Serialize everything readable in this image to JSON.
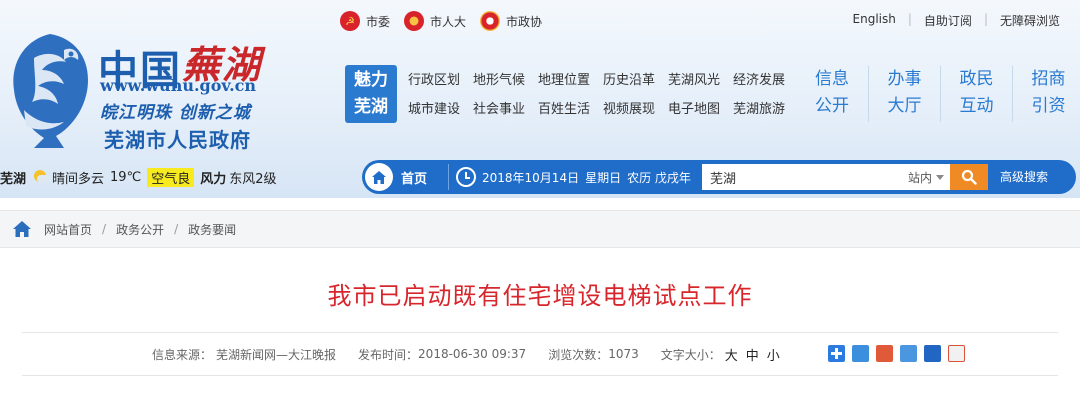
{
  "header": {
    "logo_cn": "中国",
    "logo_city": "蕪湖",
    "logo_url": "www.wuhu.gov.cn",
    "logo_slogan": "皖江明珠 创新之城",
    "logo_gov": "芜湖市人民政府",
    "top_links": [
      {
        "label": "市委",
        "icon": "party-emblem-icon"
      },
      {
        "label": "市人大",
        "icon": "npc-emblem-icon"
      },
      {
        "label": "市政协",
        "icon": "cppcc-emblem-icon"
      }
    ],
    "util_links": {
      "english": "English",
      "subscribe": "自助订阅",
      "accessible": "无障碍浏览"
    }
  },
  "nav": {
    "feature_line1": "魅力",
    "feature_line2": "芜湖",
    "sub_items": [
      "行政区划",
      "地形气候",
      "地理位置",
      "历史沿革",
      "芜湖风光",
      "经济发展",
      "城市建设",
      "社会事业",
      "百姓生活",
      "视频展现",
      "电子地图",
      "芜湖旅游"
    ],
    "big_links": [
      {
        "line1": "信息",
        "line2": "公开"
      },
      {
        "line1": "办事",
        "line2": "大厅"
      },
      {
        "line1": "政民",
        "line2": "互动"
      },
      {
        "line1": "招商",
        "line2": "引资"
      }
    ]
  },
  "weather": {
    "city": "芜湖",
    "condition": "晴间多云",
    "temp": "19℃",
    "air_quality": "空气良",
    "wind_label": "风力",
    "wind": "东风2级"
  },
  "search_bar": {
    "home_label": "首页",
    "date": "2018年10月14日",
    "weekday": "星期日",
    "lunar": "农历 戊戌年",
    "input_value": "芜湖",
    "scope": "站内",
    "advanced": "高级搜索"
  },
  "breadcrumb": {
    "items": [
      "网站首页",
      "政务公开",
      "政务要闻"
    ],
    "separator": "/"
  },
  "article": {
    "title": "我市已启动既有住宅增设电梯试点工作",
    "source_label": "信息来源：",
    "source": "芜湖新闻网—大江晚报",
    "time_label": "发布时间：",
    "time": "2018-06-30 09:37",
    "views_label": "浏览次数：",
    "views": "1073",
    "font_label": "文字大小：",
    "font_large": "大",
    "font_medium": "中",
    "font_small": "小"
  },
  "share_icons": [
    "share-plus-icon",
    "qzone-icon",
    "weibo-icon",
    "tencent-weibo-icon",
    "renren-icon",
    "kaixin-icon"
  ],
  "colors": {
    "brand_blue": "#1f6cc9",
    "title_red": "#d7262c",
    "search_orange": "#f08a24",
    "air_yellow": "#f7ea1f"
  }
}
